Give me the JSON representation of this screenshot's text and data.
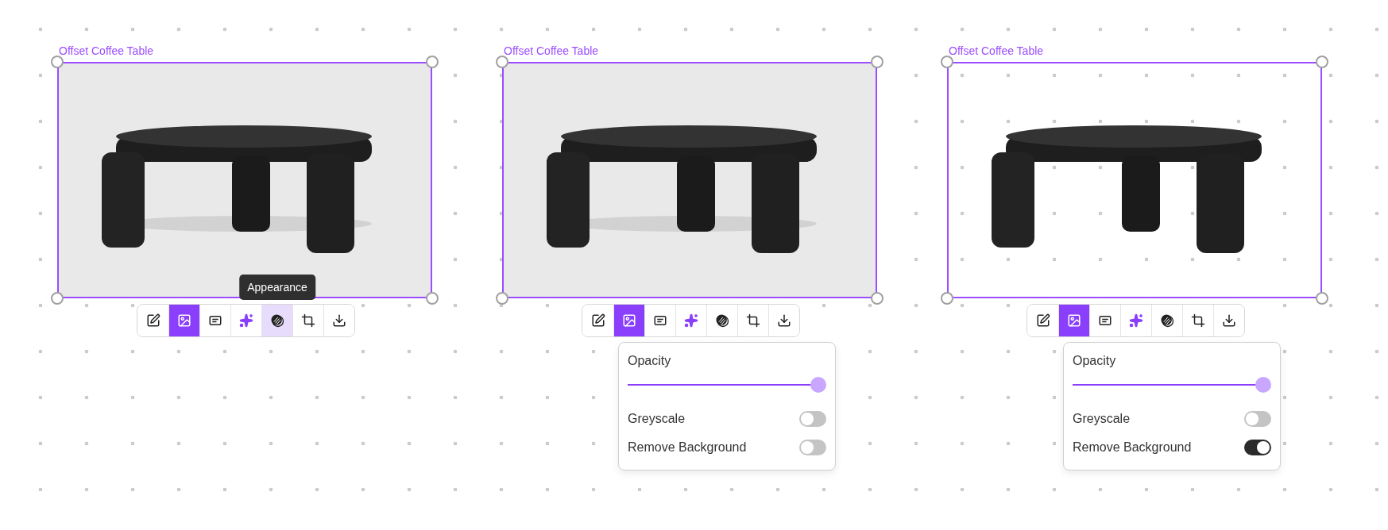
{
  "frames": [
    {
      "label": "Offset Coffee Table",
      "background_removed": false,
      "toolbar": [
        {
          "kind": "edit",
          "selected": false,
          "hovered": false
        },
        {
          "kind": "image",
          "selected": true,
          "hovered": false
        },
        {
          "kind": "caption",
          "selected": false,
          "hovered": false
        },
        {
          "kind": "ai",
          "selected": false,
          "hovered": false
        },
        {
          "kind": "appearance",
          "selected": false,
          "hovered": true,
          "tooltip": "Appearance"
        },
        {
          "kind": "crop",
          "selected": false,
          "hovered": false
        },
        {
          "kind": "download",
          "selected": false,
          "hovered": false
        }
      ]
    },
    {
      "label": "Offset Coffee Table",
      "background_removed": false,
      "toolbar": [
        {
          "kind": "edit",
          "selected": false,
          "hovered": false
        },
        {
          "kind": "image",
          "selected": true,
          "hovered": false
        },
        {
          "kind": "caption",
          "selected": false,
          "hovered": false
        },
        {
          "kind": "ai",
          "selected": false,
          "hovered": false
        },
        {
          "kind": "appearance",
          "selected": false,
          "hovered": false
        },
        {
          "kind": "crop",
          "selected": false,
          "hovered": false
        },
        {
          "kind": "download",
          "selected": false,
          "hovered": false
        }
      ],
      "popover": {
        "opacity_label": "Opacity",
        "level": 1,
        "toggles": [
          {
            "label": "Greyscale",
            "on": false
          },
          {
            "label": "Remove Background",
            "on": false
          }
        ]
      }
    },
    {
      "label": "Offset Coffee Table",
      "background_removed": true,
      "toolbar": [
        {
          "kind": "edit",
          "selected": false,
          "hovered": false
        },
        {
          "kind": "image",
          "selected": true,
          "hovered": false
        },
        {
          "kind": "caption",
          "selected": false,
          "hovered": false
        },
        {
          "kind": "ai",
          "selected": false,
          "hovered": false
        },
        {
          "kind": "appearance",
          "selected": false,
          "hovered": false
        },
        {
          "kind": "crop",
          "selected": false,
          "hovered": false
        },
        {
          "kind": "download",
          "selected": false,
          "hovered": false
        }
      ],
      "popover": {
        "opacity_label": "Opacity",
        "level": 1,
        "toggles": [
          {
            "label": "Greyscale",
            "on": false
          },
          {
            "label": "Remove Background",
            "on": true
          }
        ]
      }
    }
  ]
}
